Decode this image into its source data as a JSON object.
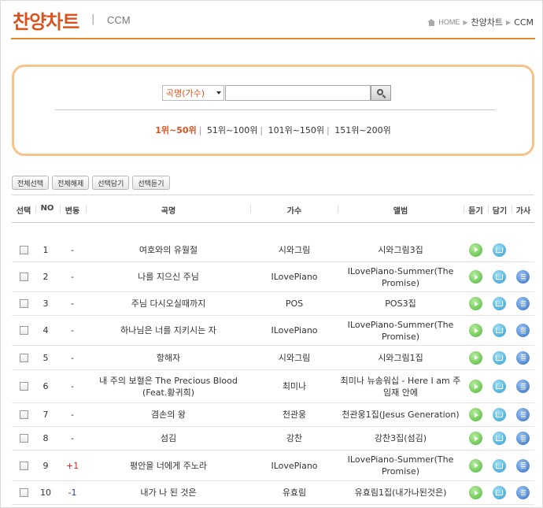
{
  "header": {
    "brand": "찬양차트",
    "separator": "|",
    "section": "CCM",
    "breadcrumb": {
      "home": "HOME",
      "level1": "찬양차트",
      "level2": "CCM"
    }
  },
  "search": {
    "select_value": "곡명(가수)",
    "input_value": "",
    "ranges": [
      "1위~50위",
      "51위~100위",
      "101위~150위",
      "151위~200위"
    ],
    "active_range": "1위~50위"
  },
  "actions": [
    "전체선택",
    "전체해제",
    "선택담기",
    "선택듣기"
  ],
  "table": {
    "headers": {
      "select": "선택",
      "no": "NO",
      "change": "변동",
      "title": "곡명",
      "artist": "가수",
      "album": "앨범",
      "listen": "듣기",
      "save": "담기",
      "lyrics": "가사"
    },
    "rows": [
      {
        "no": "1",
        "change": "-",
        "title": "여호와의 유월절",
        "artist": "시와그림",
        "album": "시와그림3집",
        "has_lyrics": false
      },
      {
        "no": "2",
        "change": "-",
        "title": "나를 지으신 주님",
        "artist": "ILovePiano",
        "album": "ILovePiano-Summer(The Promise)",
        "has_lyrics": true
      },
      {
        "no": "3",
        "change": "-",
        "title": "주님 다시오실때까지",
        "artist": "POS",
        "album": "POS3집",
        "has_lyrics": true
      },
      {
        "no": "4",
        "change": "-",
        "title": "하나님은 너를 지키시는 자",
        "artist": "ILovePiano",
        "album": "ILovePiano-Summer(The Promise)",
        "has_lyrics": true
      },
      {
        "no": "5",
        "change": "-",
        "title": "항해자",
        "artist": "시와그림",
        "album": "시와그림1집",
        "has_lyrics": true
      },
      {
        "no": "6",
        "change": "-",
        "title": "내 주의 보혈은 The Precious Blood (Feat.황귀희)",
        "artist": "최미나",
        "album": "최미나 뉴송워십 - Here I am 주 임재 안에",
        "has_lyrics": true
      },
      {
        "no": "7",
        "change": "-",
        "title": "겸손의 왕",
        "artist": "천관웅",
        "album": "천관웅1집(Jesus Generation)",
        "has_lyrics": true
      },
      {
        "no": "8",
        "change": "-",
        "title": "섬김",
        "artist": "강찬",
        "album": "강찬3집(섬김)",
        "has_lyrics": true
      },
      {
        "no": "9",
        "change": "+1",
        "title": "평안을 너에게 주노라",
        "artist": "ILovePiano",
        "album": "ILovePiano-Summer(The Promise)",
        "has_lyrics": true
      },
      {
        "no": "10",
        "change": "-1",
        "title": "내가 나 된 것은",
        "artist": "유효림",
        "album": "유효림1집(내가나된것은)",
        "has_lyrics": true
      }
    ]
  },
  "colors": {
    "brand": "#d8531f",
    "accent_border": "#f4c488",
    "up": "#dd2222",
    "down": "#2a3ab5"
  },
  "icons": {
    "listen": "play-icon",
    "save": "download-icon",
    "lyrics": "lyrics-icon",
    "search": "search-icon",
    "home": "home-icon"
  }
}
